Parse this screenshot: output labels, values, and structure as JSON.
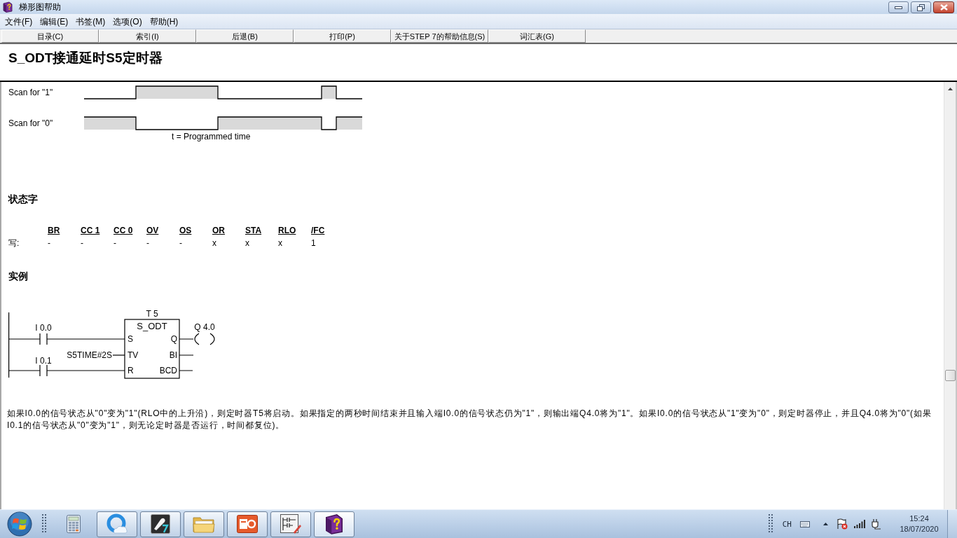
{
  "window": {
    "title": "梯形图帮助"
  },
  "menu_bar": [
    "文件(F)",
    "编辑(E)",
    "书签(M)",
    "选项(O)",
    "帮助(H)"
  ],
  "button_bar": [
    "目录(C)",
    "索引(I)",
    "后退(B)",
    "打印(P)",
    "关于STEP 7的帮助信息(S)",
    "词汇表(G)"
  ],
  "topic_title": "S_ODT接通延时S5定时器",
  "timing_diagram": {
    "rows": [
      {
        "label": "Scan for \"1\"",
        "kind": "active-high"
      },
      {
        "label": "Scan for \"0\"",
        "kind": "active-low"
      }
    ],
    "caption": "t = Programmed time"
  },
  "status_word": {
    "heading": "状态字",
    "columns": [
      "BR",
      "CC 1",
      "CC 0",
      "OV",
      "OS",
      "OR",
      "STA",
      "RLO",
      "/FC"
    ],
    "rows": [
      {
        "label": "写:",
        "values": [
          "-",
          "-",
          "-",
          "-",
          "-",
          "x",
          "x",
          "x",
          "1"
        ]
      }
    ]
  },
  "example": {
    "heading": "实例",
    "ladder": {
      "timer": "T 5",
      "block": "S_ODT",
      "contacts": [
        "I 0.0",
        "I 0.1"
      ],
      "preset": "S5TIME#2S",
      "inputs": [
        "S",
        "TV",
        "R"
      ],
      "outputs": [
        "Q",
        "BI",
        "BCD"
      ],
      "coil": "Q 4.0"
    },
    "description": "如果I0.0的信号状态从\"0\"变为\"1\"(RLO中的上升沿)，则定时器T5将启动。如果指定的两秒时间结束并且输入端I0.0的信号状态仍为\"1\"，则输出端Q4.0将为\"1\"。如果I0.0的信号状态从\"1\"变为\"0\"，则定时器停止，并且Q4.0将为\"0\"(如果I0.1的信号状态从\"0\"变为\"1\"，则无论定时器是否运行，时间都复位)。"
  },
  "taskbar": {
    "items": [
      {
        "kind": "calculator",
        "running": false,
        "selected": false
      },
      {
        "kind": "browser",
        "running": true,
        "selected": false
      },
      {
        "kind": "pen-tool",
        "running": true,
        "selected": false
      },
      {
        "kind": "folder",
        "running": true,
        "selected": false
      },
      {
        "kind": "slideshow",
        "running": true,
        "selected": false
      },
      {
        "kind": "ladder-editor",
        "running": true,
        "selected": false
      },
      {
        "kind": "help-book",
        "running": true,
        "selected": true
      }
    ],
    "language": "CH",
    "clock": {
      "time": "15:24",
      "date": "18/07/2020"
    }
  }
}
